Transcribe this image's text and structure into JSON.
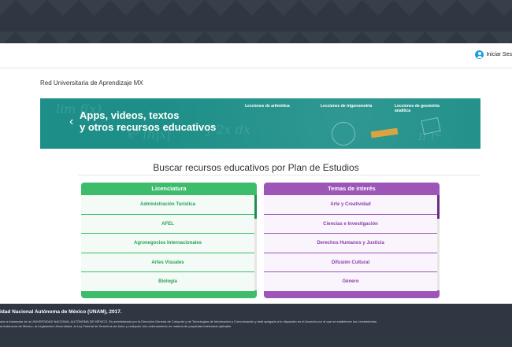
{
  "header": {
    "login_label": "Iniciar Ses"
  },
  "site": {
    "title": "Red Universitaria de Aprendizaje MX"
  },
  "banner": {
    "headline_line1": "Apps, videos, textos",
    "headline_line2": "y otros recursos educativos",
    "links": [
      "Lecciones de aritmética",
      "Lecciones de trigonometría",
      "Lecciones de geometría analítica"
    ],
    "prev_icon": "chevron-left-icon",
    "next_icon": "chevron-right-icon"
  },
  "search": {
    "title": "Buscar recursos educativos por Plan de Estudios"
  },
  "licenciatura": {
    "title": "Licenciatura",
    "items": [
      "Administración Turística",
      "AFEL",
      "Agronegocios Internacionales",
      "Artes Visuales",
      "Biología"
    ]
  },
  "temas": {
    "title": "Temas de interés",
    "items": [
      "Arte y Creatividad",
      "Ciencias e Investigación",
      "Derechos Humanos y Justicia",
      "Difusión Cultural",
      "Género"
    ]
  },
  "footer": {
    "copyright": "idad Nacional Autónoma de México (UNAM), 2017.",
    "legal_line1": "ado a Instancias de la UNIVERSIDAD NACIONAL AUTÓNOMA DE MÉXICO. Es administrado por la Dirección General de Cómputo y de Tecnologías de Información y Comunicación y está apegado a lo dispuesto en el Acuerdo por el que se establecen los Lineamientos",
    "legal_line2": "al Autónoma de México, la Legislación Universitaria, la Ley Federal de Derechos de Autor y cualquier otro ordenamiento en materia de propiedad intelectual aplicable."
  },
  "colors": {
    "green": "#3dbc6b",
    "purple": "#9d55b8",
    "banner": "#1e8f88",
    "dark": "#2f3743",
    "outer": "#5ab5e2"
  }
}
